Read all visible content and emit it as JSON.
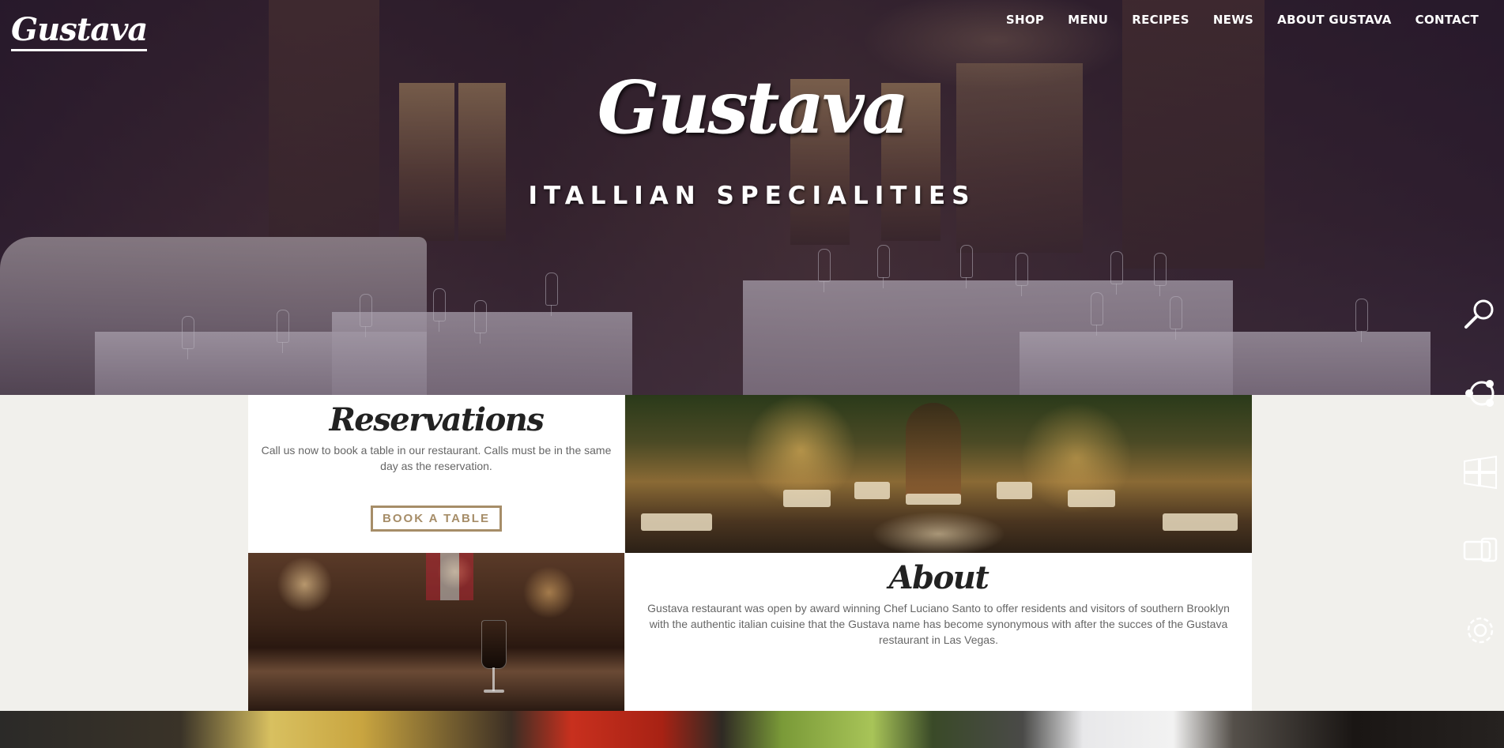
{
  "header": {
    "logo": "Gustava",
    "nav": [
      "SHOP",
      "MENU",
      "RECIPES",
      "NEWS",
      "ABOUT GUSTAVA",
      "CONTACT"
    ]
  },
  "hero": {
    "title": "Gustava",
    "subtitle": "ITALLIAN SPECIALITIES"
  },
  "reservations": {
    "title": "Reservations",
    "text": "Call us now to book a table in our restaurant. Calls must be in the same day as the reservation.",
    "button": "BOOK A TABLE"
  },
  "about": {
    "title": "About",
    "text": "Gustava restaurant was open by award winning Chef Luciano Santo to offer residents and visitors of southern Brooklyn with the authentic italian cuisine that the Gustava name has become synonymous with after the succes of the Gustava restaurant in Las Vegas."
  },
  "charms": [
    "search-icon",
    "share-icon",
    "start-icon",
    "devices-icon",
    "settings-icon"
  ],
  "colors": {
    "accent": "#a68d68",
    "background": "#f1f0ec"
  }
}
